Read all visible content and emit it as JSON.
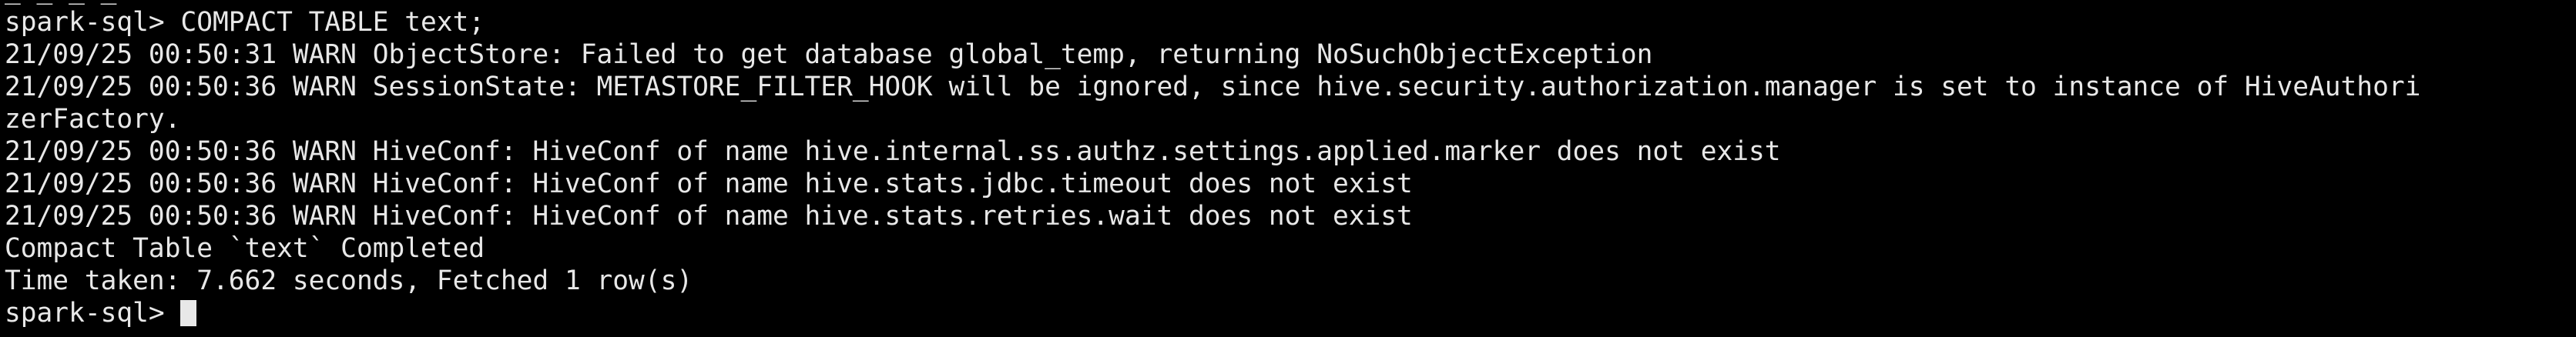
{
  "window": {
    "background": "#000000",
    "foreground": "#e8e8e8",
    "clipped_top_fragment": "_ _ _ _"
  },
  "terminal": {
    "lines": [
      "spark-sql> COMPACT TABLE text;",
      "21/09/25 00:50:31 WARN ObjectStore: Failed to get database global_temp, returning NoSuchObjectException",
      "21/09/25 00:50:36 WARN SessionState: METASTORE_FILTER_HOOK will be ignored, since hive.security.authorization.manager is set to instance of HiveAuthori",
      "zerFactory.",
      "21/09/25 00:50:36 WARN HiveConf: HiveConf of name hive.internal.ss.authz.settings.applied.marker does not exist",
      "21/09/25 00:50:36 WARN HiveConf: HiveConf of name hive.stats.jdbc.timeout does not exist",
      "21/09/25 00:50:36 WARN HiveConf: HiveConf of name hive.stats.retries.wait does not exist",
      "Compact Table `text` Completed",
      "Time taken: 7.662 seconds, Fetched 1 row(s)"
    ],
    "prompt": "spark-sql> "
  }
}
